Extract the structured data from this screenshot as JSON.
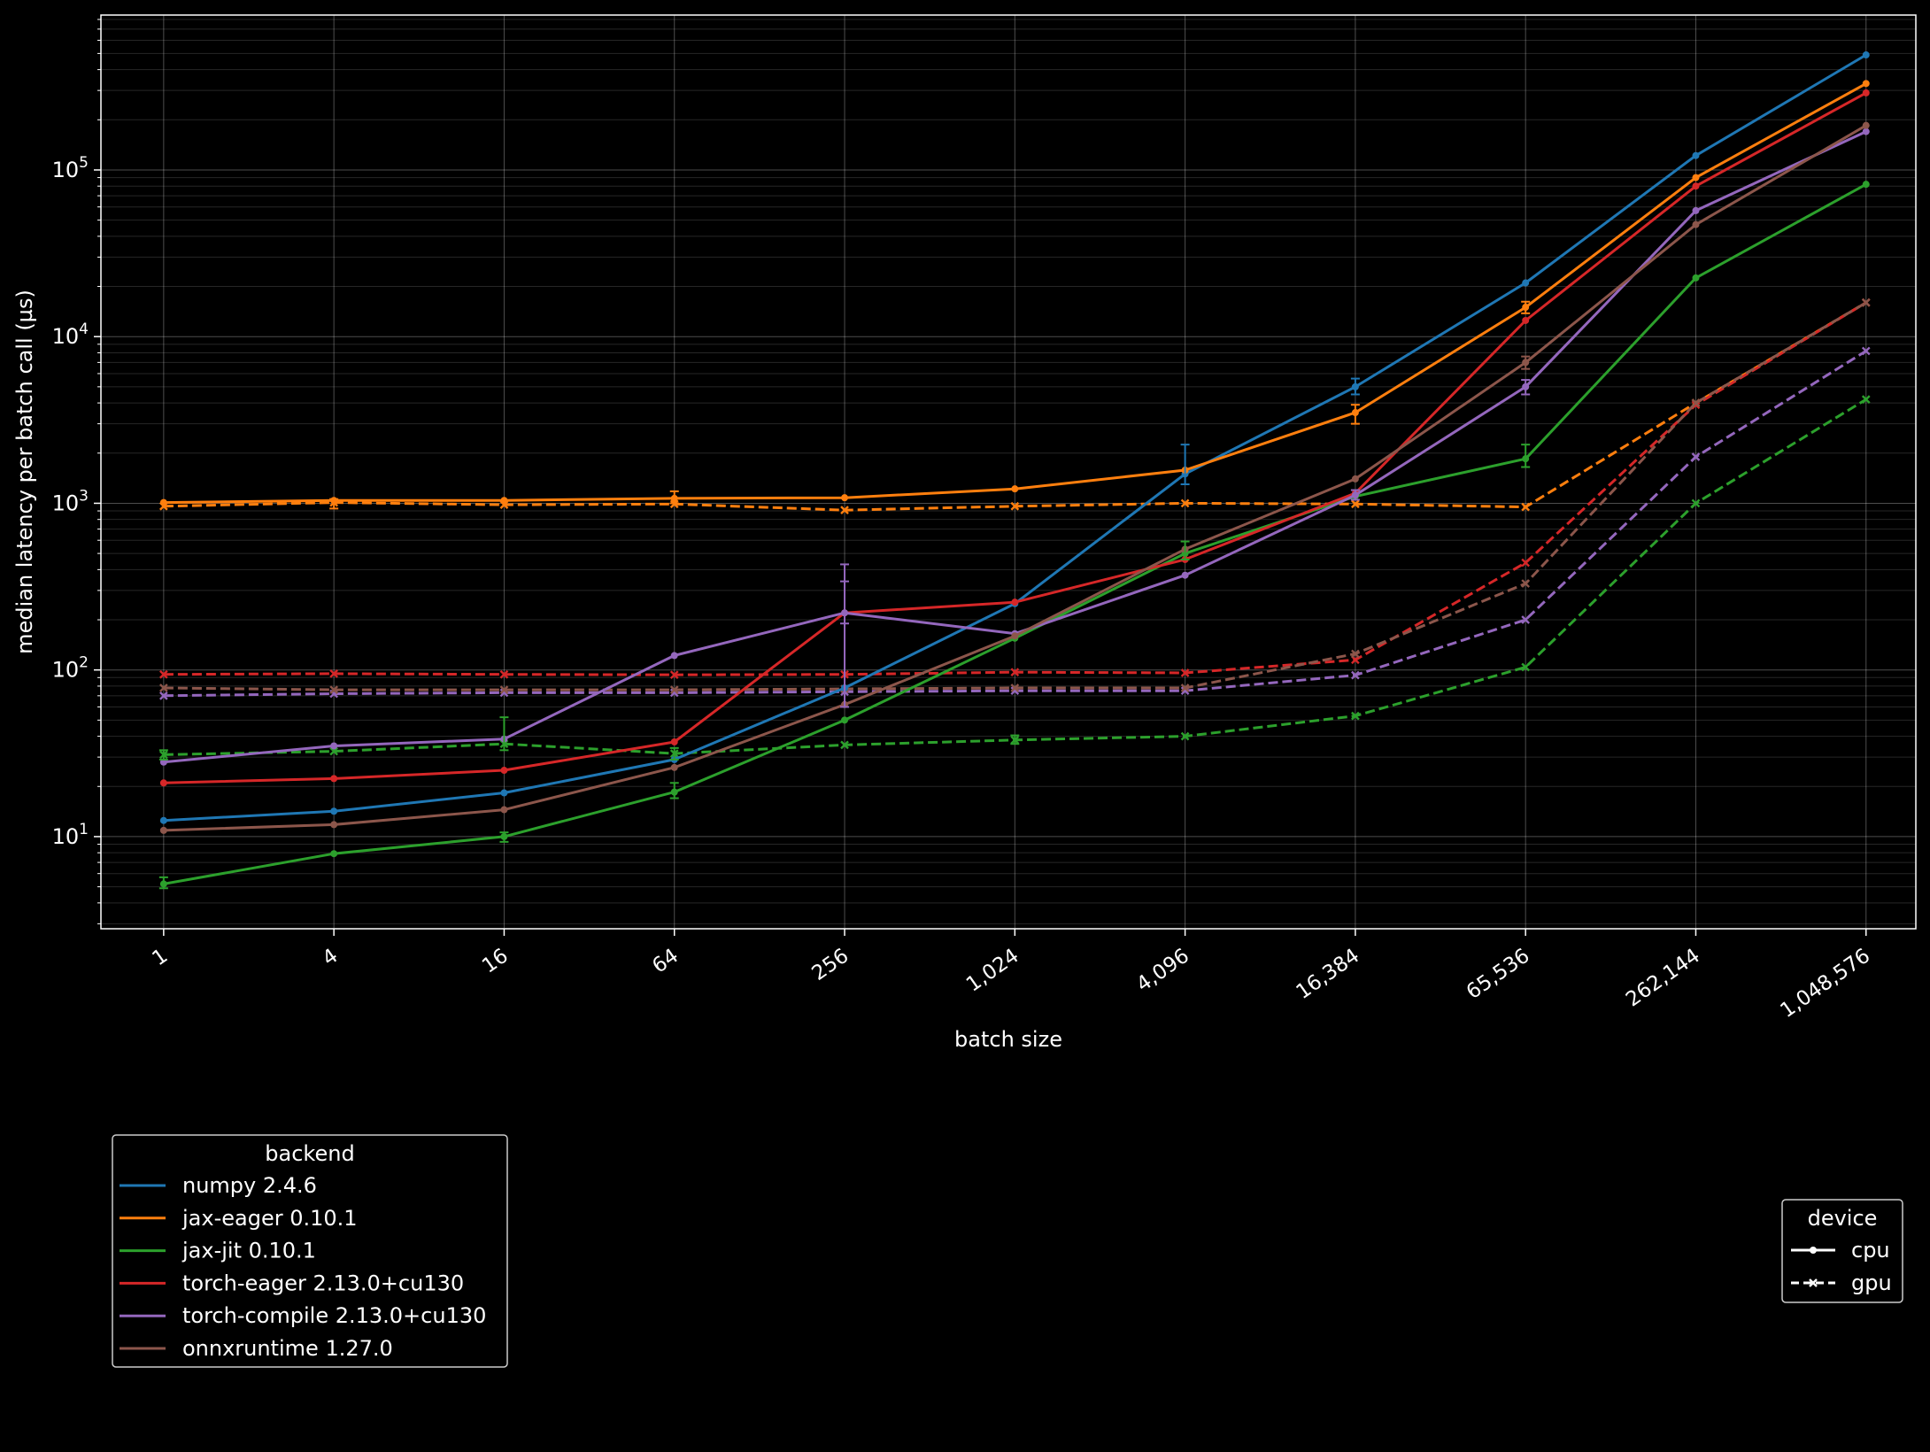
{
  "chart_data": {
    "type": "line",
    "title": "",
    "xlabel": "batch size",
    "ylabel": "median latency per batch call (µs)",
    "x_scale": "log2",
    "y_scale": "log10",
    "xlim": [
      0.6,
      1572864
    ],
    "ylim": [
      2.8,
      850000
    ],
    "grid": true,
    "x": [
      1,
      4,
      16,
      64,
      256,
      1024,
      4096,
      16384,
      65536,
      262144,
      1048576
    ],
    "x_tick_labels": [
      "1",
      "4",
      "16",
      "64",
      "256",
      "1,024",
      "4,096",
      "16,384",
      "65,536",
      "262,144",
      "1,048,576"
    ],
    "y_ticks": [
      {
        "value": 10,
        "base": "10",
        "exp": "1"
      },
      {
        "value": 100,
        "base": "10",
        "exp": "2"
      },
      {
        "value": 1000,
        "base": "10",
        "exp": "3"
      },
      {
        "value": 10000,
        "base": "10",
        "exp": "4"
      },
      {
        "value": 100000,
        "base": "10",
        "exp": "5"
      }
    ],
    "series": [
      {
        "name": "numpy 2.4.6",
        "backend_index": 0,
        "device": "cpu",
        "color": "#1f77b4",
        "values": [
          12.5,
          14.2,
          18.3,
          29,
          78,
          250,
          1500,
          5000,
          21000,
          122000,
          490000
        ]
      },
      {
        "name": "jax-eager 0.10.1",
        "backend_index": 1,
        "device": "cpu",
        "color": "#ff7f0e",
        "values": [
          1010,
          1040,
          1040,
          1070,
          1080,
          1220,
          1580,
          3500,
          15000,
          90000,
          330000
        ]
      },
      {
        "name": "jax-jit 0.10.1",
        "backend_index": 2,
        "device": "cpu",
        "color": "#2ca02c",
        "values": [
          5.2,
          7.9,
          10,
          18.5,
          50,
          155,
          500,
          1100,
          1850,
          22500,
          82000
        ]
      },
      {
        "name": "torch-eager 2.13.0+cu130",
        "backend_index": 3,
        "device": "cpu",
        "color": "#d62728",
        "values": [
          21,
          22.3,
          25,
          37,
          220,
          255,
          460,
          1150,
          12500,
          80000,
          290000
        ]
      },
      {
        "name": "torch-compile 2.13.0+cu130",
        "backend_index": 4,
        "device": "cpu",
        "color": "#9467bd",
        "values": [
          28,
          35,
          38.5,
          122,
          220,
          165,
          370,
          1120,
          5000,
          57000,
          170000
        ]
      },
      {
        "name": "onnxruntime 1.27.0",
        "backend_index": 5,
        "device": "cpu",
        "color": "#8c564b",
        "values": [
          10.9,
          11.8,
          14.5,
          26,
          62,
          160,
          530,
          1400,
          7000,
          47000,
          185000
        ]
      },
      {
        "name": "jax-eager 0.10.1",
        "backend_index": 1,
        "device": "gpu",
        "color": "#ff7f0e",
        "values": [
          960,
          1010,
          980,
          990,
          910,
          960,
          1000,
          990,
          950,
          4000,
          16000
        ]
      },
      {
        "name": "jax-jit 0.10.1",
        "backend_index": 2,
        "device": "gpu",
        "color": "#2ca02c",
        "values": [
          31,
          32.5,
          36,
          31.5,
          35.5,
          38,
          40,
          53,
          104,
          1000,
          4200
        ]
      },
      {
        "name": "torch-eager 2.13.0+cu130",
        "backend_index": 3,
        "device": "gpu",
        "color": "#d62728",
        "values": [
          94,
          95,
          94,
          93.5,
          94,
          97,
          96,
          115,
          440,
          3900,
          16000
        ]
      },
      {
        "name": "torch-compile 2.13.0+cu130",
        "backend_index": 4,
        "device": "gpu",
        "color": "#9467bd",
        "values": [
          70,
          72,
          73,
          73,
          74,
          75,
          75,
          93,
          200,
          1900,
          8200
        ]
      },
      {
        "name": "onnxruntime 1.27.0",
        "backend_index": 5,
        "device": "gpu",
        "color": "#8c564b",
        "values": [
          78,
          76,
          76,
          76,
          77,
          78,
          78,
          125,
          330,
          4000,
          16000
        ]
      }
    ],
    "error_bars": [
      {
        "series": 0,
        "x_index": 6,
        "low": 1300,
        "high": 2250
      },
      {
        "series": 0,
        "x_index": 7,
        "low": 4500,
        "high": 5600
      },
      {
        "series": 1,
        "x_index": 7,
        "low": 3000,
        "high": 3900
      },
      {
        "series": 1,
        "x_index": 8,
        "low": 13800,
        "high": 16200
      },
      {
        "series": 1,
        "x_index": 3,
        "low": 1000,
        "high": 1180
      },
      {
        "series": 2,
        "x_index": 2,
        "low": 9.3,
        "high": 10.6
      },
      {
        "series": 2,
        "x_index": 3,
        "low": 17,
        "high": 21
      },
      {
        "series": 2,
        "x_index": 6,
        "low": 460,
        "high": 590
      },
      {
        "series": 2,
        "x_index": 8,
        "low": 1650,
        "high": 2250
      },
      {
        "series": 2,
        "x_index": 0,
        "low": 4.9,
        "high": 5.7
      },
      {
        "series": 4,
        "x_index": 4,
        "low": 190,
        "high": 430
      },
      {
        "series": 4,
        "x_index": 8,
        "low": 4500,
        "high": 5500
      },
      {
        "series": 4,
        "x_index": 7,
        "low": 1050,
        "high": 1200
      },
      {
        "series": 5,
        "x_index": 8,
        "low": 6400,
        "high": 7600
      },
      {
        "series": 7,
        "x_index": 2,
        "low": 33,
        "high": 52
      },
      {
        "series": 7,
        "x_index": 3,
        "low": 29,
        "high": 34
      },
      {
        "series": 7,
        "x_index": 0,
        "low": 29,
        "high": 33
      },
      {
        "series": 7,
        "x_index": 5,
        "low": 36,
        "high": 40.5
      },
      {
        "series": 9,
        "x_index": 4,
        "low": 60,
        "high": 340
      },
      {
        "series": 6,
        "x_index": 1,
        "low": 930,
        "high": 1060
      }
    ],
    "legend_backend": {
      "title": "backend",
      "placement": "below-left",
      "entries": [
        {
          "label": "numpy 2.4.6",
          "color": "#1f77b4"
        },
        {
          "label": "jax-eager 0.10.1",
          "color": "#ff7f0e"
        },
        {
          "label": "jax-jit 0.10.1",
          "color": "#2ca02c"
        },
        {
          "label": "torch-eager 2.13.0+cu130",
          "color": "#d62728"
        },
        {
          "label": "torch-compile 2.13.0+cu130",
          "color": "#9467bd"
        },
        {
          "label": "onnxruntime 1.27.0",
          "color": "#8c564b"
        }
      ]
    },
    "legend_device": {
      "title": "device",
      "placement": "below-right",
      "entries": [
        {
          "label": "cpu",
          "style": "solid",
          "marker": "dot"
        },
        {
          "label": "gpu",
          "style": "dashed",
          "marker": "x"
        }
      ]
    }
  }
}
